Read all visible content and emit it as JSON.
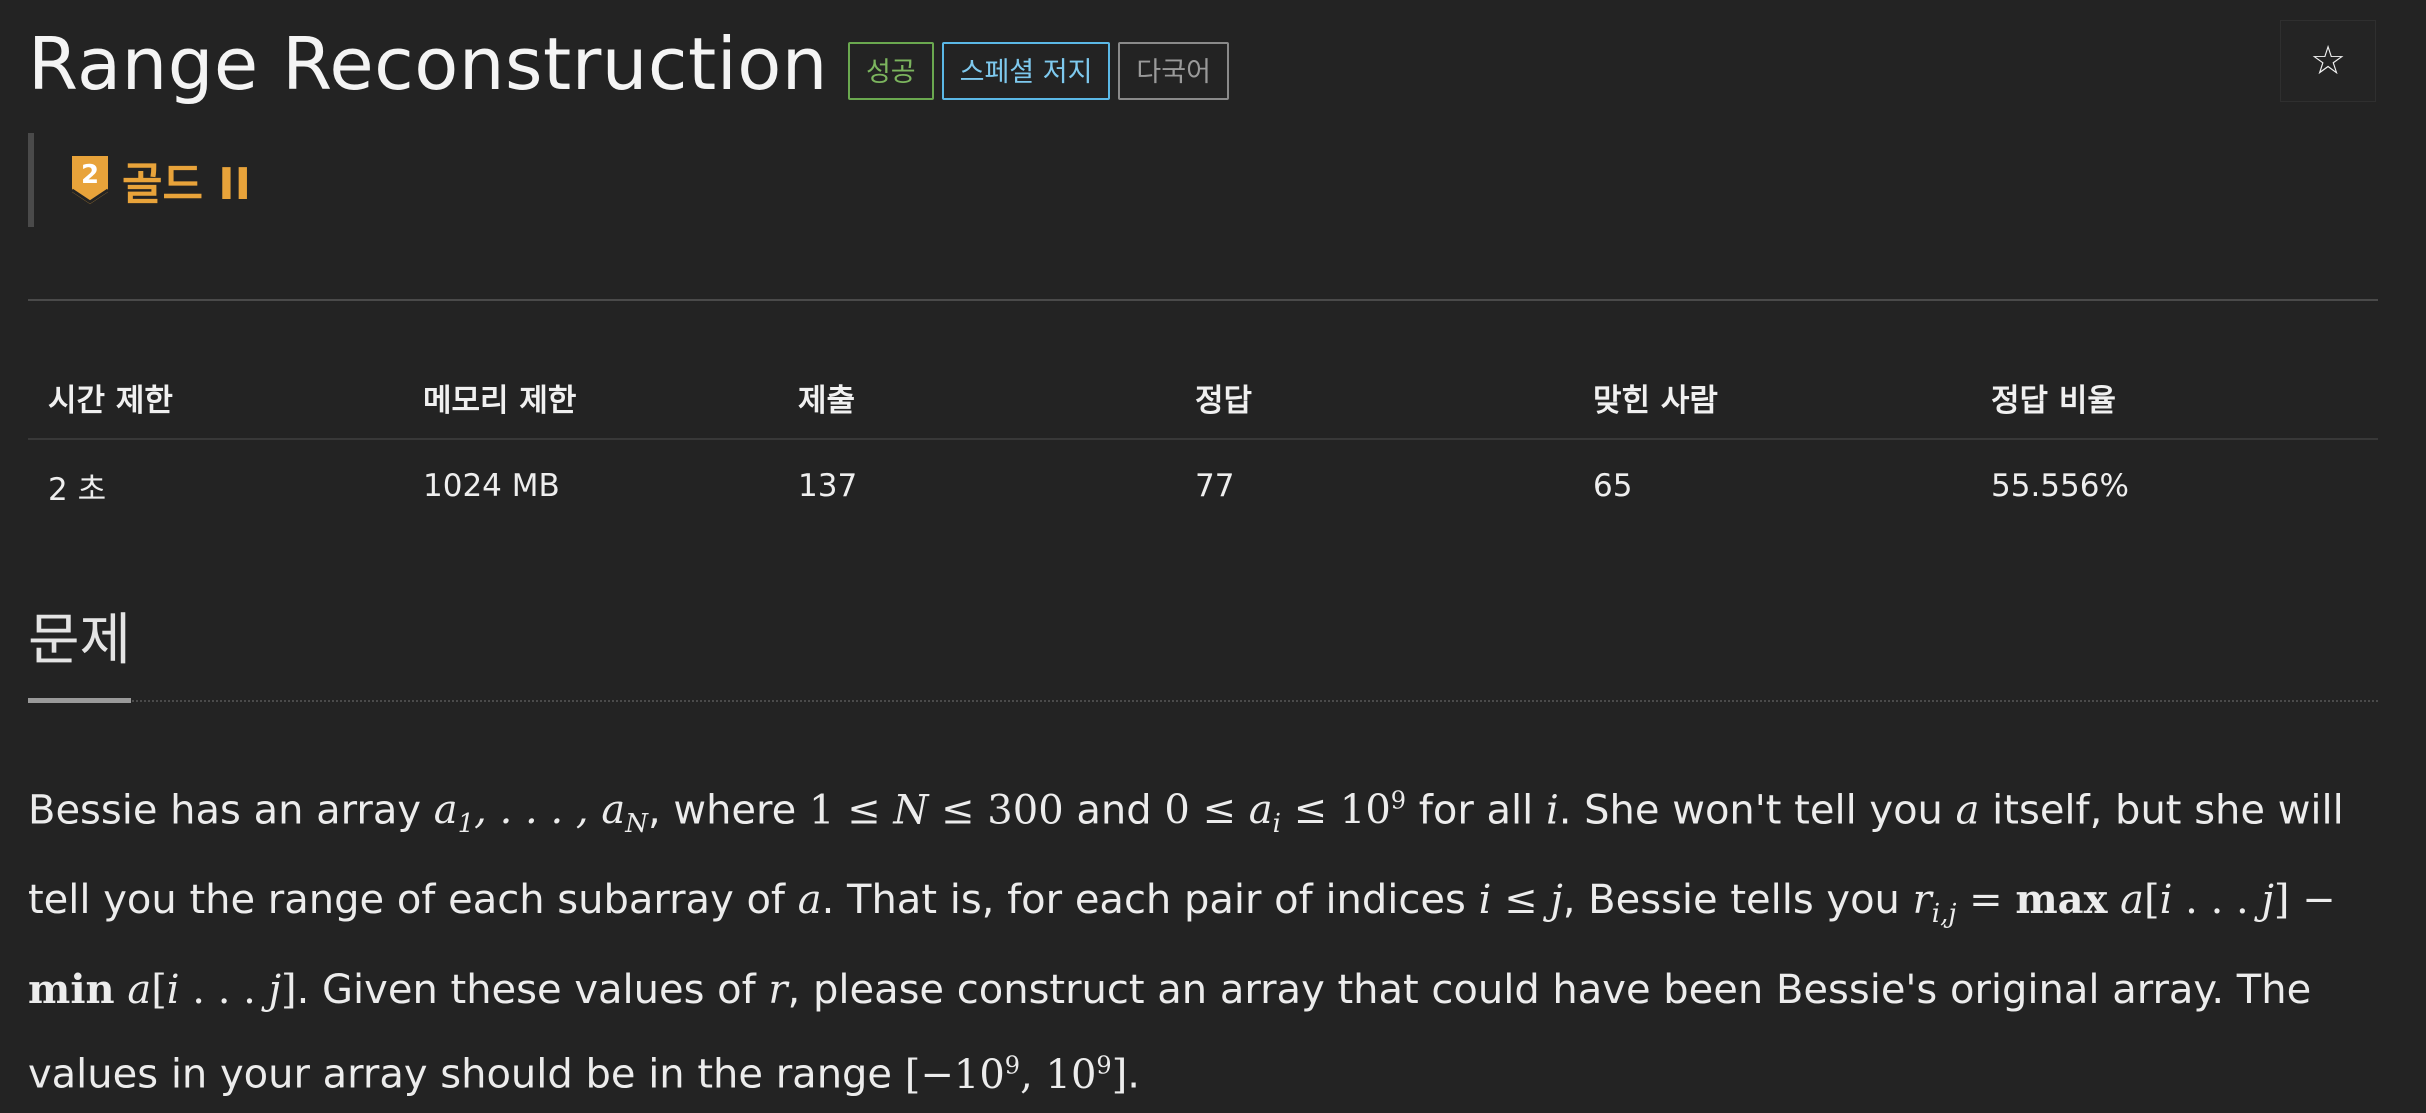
{
  "header": {
    "title": "Range Reconstruction",
    "labels": [
      "성공",
      "스페셜 저지",
      "다국어"
    ],
    "star_icon": "star-icon"
  },
  "tier": {
    "number": "2",
    "text": "골드 II",
    "color": "#e8a33a"
  },
  "info_table": {
    "headers": [
      "시간 제한",
      "메모리 제한",
      "제출",
      "정답",
      "맞힌 사람",
      "정답 비율"
    ],
    "values": [
      "2 초",
      "1024 MB",
      "137",
      "77",
      "65",
      "55.556%"
    ]
  },
  "section": {
    "title": "문제"
  },
  "problem": {
    "t1": "Bessie has an array ",
    "t2": ", where ",
    "t3": " and ",
    "t4": " for all ",
    "t5": ". She won't tell you ",
    "t6": " itself, but she will tell you the range of each subarray of ",
    "t7": ". That is, for each pair of indices ",
    "t8": ", Bessie tells you ",
    "t9": ". Given these values of ",
    "t10": ", please construct an array that could have been Bessie's original array. The values in your array should be in the range ",
    "t11": "."
  }
}
